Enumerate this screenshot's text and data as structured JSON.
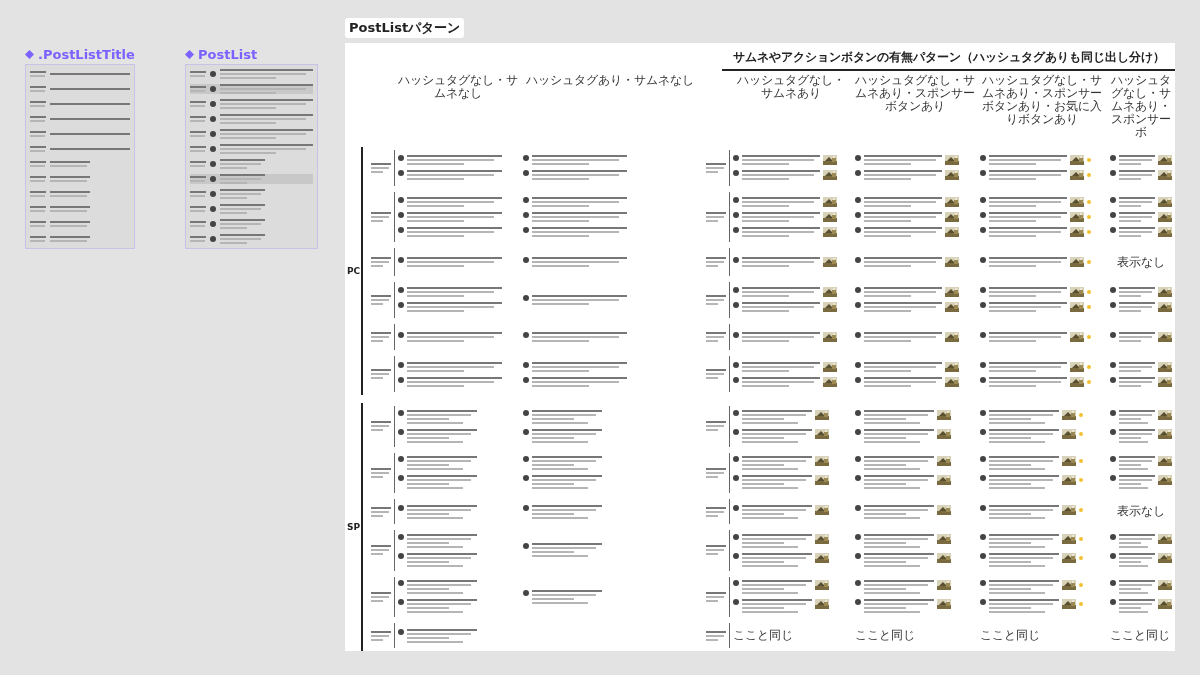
{
  "components": [
    {
      "title": ".PostListTitle",
      "kind": "title-list"
    },
    {
      "title": "PostList",
      "kind": "post-list"
    }
  ],
  "frame": {
    "title": "PostListパターン",
    "group_header": "サムネやアクションボタンの有無パターン（ハッシュタグありも同じ出し分け）",
    "columns": [
      {
        "header": "ハッシュタグなし・サムネなし",
        "thumbnail": false,
        "favorite": false
      },
      {
        "header": "ハッシュタグあり・サムネなし",
        "thumbnail": false,
        "favorite": false
      },
      {
        "header": "ハッシュタグなし・サムネあり",
        "thumbnail": true,
        "favorite": false
      },
      {
        "header": "ハッシュタグなし・サムネあり・スポンサーボタンあり",
        "thumbnail": true,
        "favorite": false
      },
      {
        "header": "ハッシュタグなし・サムネあり・スポンサーボタンあり・お気に入りボタンあり",
        "thumbnail": true,
        "favorite": true
      },
      {
        "header": "ハッシュタグなし・サムネあり・スポンサーボ",
        "thumbnail": true,
        "favorite": false
      }
    ],
    "sections": [
      {
        "label": "PC",
        "kind": "wide",
        "rows": [
          {
            "cells": [
              {
                "kind": "posts",
                "items": [
                  {
                    "kind": "post"
                  },
                  {
                    "kind": "post"
                  }
                ]
              },
              {
                "kind": "posts",
                "items": [
                  {
                    "kind": "post"
                  },
                  {
                    "kind": "post"
                  }
                ]
              },
              {
                "kind": "posts",
                "items": [
                  {
                    "kind": "post"
                  },
                  {
                    "kind": "post"
                  }
                ]
              },
              {
                "kind": "posts",
                "items": [
                  {
                    "kind": "post"
                  },
                  {
                    "kind": "post"
                  }
                ]
              },
              {
                "kind": "posts",
                "items": [
                  {
                    "kind": "post"
                  },
                  {
                    "kind": "post"
                  }
                ]
              },
              {
                "kind": "posts",
                "items": [
                  {
                    "kind": "post"
                  },
                  {
                    "kind": "post"
                  }
                ]
              }
            ]
          },
          {
            "cells": [
              {
                "kind": "posts",
                "items": [
                  {
                    "kind": "post"
                  },
                  {
                    "kind": "post"
                  },
                  {
                    "kind": "post"
                  }
                ]
              },
              {
                "kind": "posts",
                "items": [
                  {
                    "kind": "post"
                  },
                  {
                    "kind": "post"
                  },
                  {
                    "kind": "post"
                  }
                ]
              },
              {
                "kind": "posts",
                "items": [
                  {
                    "kind": "post"
                  },
                  {
                    "kind": "post"
                  },
                  {
                    "kind": "post"
                  }
                ]
              },
              {
                "kind": "posts",
                "items": [
                  {
                    "kind": "post"
                  },
                  {
                    "kind": "post"
                  },
                  {
                    "kind": "post"
                  }
                ]
              },
              {
                "kind": "posts",
                "items": [
                  {
                    "kind": "post"
                  },
                  {
                    "kind": "post"
                  },
                  {
                    "kind": "post"
                  }
                ]
              },
              {
                "kind": "posts",
                "items": [
                  {
                    "kind": "post"
                  },
                  {
                    "kind": "post"
                  },
                  {
                    "kind": "post"
                  }
                ]
              }
            ]
          },
          {
            "cells": [
              {
                "kind": "posts",
                "items": [
                  {
                    "kind": "post"
                  }
                ]
              },
              {
                "kind": "posts",
                "items": [
                  {
                    "kind": "post"
                  }
                ]
              },
              {
                "kind": "posts",
                "items": [
                  {
                    "kind": "post"
                  }
                ]
              },
              {
                "kind": "posts",
                "items": [
                  {
                    "kind": "post"
                  }
                ]
              },
              {
                "kind": "posts",
                "items": [
                  {
                    "kind": "post"
                  }
                ]
              },
              {
                "kind": "note",
                "text": "表示なし"
              }
            ]
          },
          {
            "cells": [
              {
                "kind": "posts",
                "items": [
                  {
                    "kind": "post"
                  },
                  {
                    "kind": "post"
                  }
                ]
              },
              {
                "kind": "posts",
                "items": [
                  {
                    "kind": "post"
                  }
                ]
              },
              {
                "kind": "posts",
                "items": [
                  {
                    "kind": "post"
                  },
                  {
                    "kind": "post"
                  }
                ]
              },
              {
                "kind": "posts",
                "items": [
                  {
                    "kind": "post"
                  },
                  {
                    "kind": "post"
                  }
                ]
              },
              {
                "kind": "posts",
                "items": [
                  {
                    "kind": "post"
                  },
                  {
                    "kind": "post"
                  }
                ]
              },
              {
                "kind": "posts",
                "items": [
                  {
                    "kind": "post"
                  },
                  {
                    "kind": "post"
                  }
                ]
              }
            ]
          },
          {
            "cells": [
              {
                "kind": "posts",
                "items": [
                  {
                    "kind": "post"
                  }
                ]
              },
              {
                "kind": "posts",
                "items": [
                  {
                    "kind": "post"
                  }
                ]
              },
              {
                "kind": "posts",
                "items": [
                  {
                    "kind": "post"
                  }
                ]
              },
              {
                "kind": "posts",
                "items": [
                  {
                    "kind": "post"
                  }
                ]
              },
              {
                "kind": "posts",
                "items": [
                  {
                    "kind": "post"
                  }
                ]
              },
              {
                "kind": "posts",
                "items": [
                  {
                    "kind": "post"
                  }
                ]
              }
            ]
          },
          {
            "cells": [
              {
                "kind": "posts",
                "items": [
                  {
                    "kind": "post"
                  },
                  {
                    "kind": "post"
                  }
                ]
              },
              {
                "kind": "posts",
                "items": [
                  {
                    "kind": "post"
                  },
                  {
                    "kind": "post"
                  }
                ]
              },
              {
                "kind": "posts",
                "items": [
                  {
                    "kind": "post"
                  },
                  {
                    "kind": "post"
                  }
                ]
              },
              {
                "kind": "posts",
                "items": [
                  {
                    "kind": "post"
                  },
                  {
                    "kind": "post"
                  }
                ]
              },
              {
                "kind": "posts",
                "items": [
                  {
                    "kind": "post"
                  },
                  {
                    "kind": "post"
                  }
                ]
              },
              {
                "kind": "posts",
                "items": [
                  {
                    "kind": "post"
                  },
                  {
                    "kind": "post"
                  }
                ]
              }
            ]
          }
        ]
      },
      {
        "label": "SP",
        "kind": "narrow",
        "rows": [
          {
            "cells": [
              {
                "kind": "posts",
                "items": [
                  {
                    "kind": "post"
                  },
                  {
                    "kind": "post"
                  }
                ]
              },
              {
                "kind": "posts",
                "items": [
                  {
                    "kind": "post"
                  },
                  {
                    "kind": "post"
                  }
                ]
              },
              {
                "kind": "posts",
                "items": [
                  {
                    "kind": "post"
                  },
                  {
                    "kind": "post"
                  }
                ]
              },
              {
                "kind": "posts",
                "items": [
                  {
                    "kind": "post"
                  },
                  {
                    "kind": "post"
                  }
                ]
              },
              {
                "kind": "posts",
                "items": [
                  {
                    "kind": "post"
                  },
                  {
                    "kind": "post"
                  }
                ]
              },
              {
                "kind": "posts",
                "items": [
                  {
                    "kind": "post"
                  },
                  {
                    "kind": "post"
                  }
                ]
              }
            ]
          },
          {
            "cells": [
              {
                "kind": "posts",
                "items": [
                  {
                    "kind": "post"
                  },
                  {
                    "kind": "post"
                  }
                ]
              },
              {
                "kind": "posts",
                "items": [
                  {
                    "kind": "post"
                  },
                  {
                    "kind": "post"
                  }
                ]
              },
              {
                "kind": "posts",
                "items": [
                  {
                    "kind": "post"
                  },
                  {
                    "kind": "post"
                  }
                ]
              },
              {
                "kind": "posts",
                "items": [
                  {
                    "kind": "post"
                  },
                  {
                    "kind": "post"
                  }
                ]
              },
              {
                "kind": "posts",
                "items": [
                  {
                    "kind": "post"
                  },
                  {
                    "kind": "post"
                  }
                ]
              },
              {
                "kind": "posts",
                "items": [
                  {
                    "kind": "post"
                  },
                  {
                    "kind": "post"
                  }
                ]
              }
            ]
          },
          {
            "cells": [
              {
                "kind": "posts",
                "items": [
                  {
                    "kind": "post"
                  }
                ]
              },
              {
                "kind": "posts",
                "items": [
                  {
                    "kind": "post"
                  }
                ]
              },
              {
                "kind": "posts",
                "items": [
                  {
                    "kind": "post"
                  }
                ]
              },
              {
                "kind": "posts",
                "items": [
                  {
                    "kind": "post"
                  }
                ]
              },
              {
                "kind": "posts",
                "items": [
                  {
                    "kind": "post"
                  }
                ]
              },
              {
                "kind": "note",
                "text": "表示なし"
              }
            ]
          },
          {
            "cells": [
              {
                "kind": "posts",
                "items": [
                  {
                    "kind": "post"
                  },
                  {
                    "kind": "post"
                  }
                ]
              },
              {
                "kind": "posts",
                "items": [
                  {
                    "kind": "post"
                  }
                ]
              },
              {
                "kind": "posts",
                "items": [
                  {
                    "kind": "post"
                  },
                  {
                    "kind": "post"
                  }
                ]
              },
              {
                "kind": "posts",
                "items": [
                  {
                    "kind": "post"
                  },
                  {
                    "kind": "post"
                  }
                ]
              },
              {
                "kind": "posts",
                "items": [
                  {
                    "kind": "post"
                  },
                  {
                    "kind": "post"
                  }
                ]
              },
              {
                "kind": "posts",
                "items": [
                  {
                    "kind": "post"
                  },
                  {
                    "kind": "post"
                  }
                ]
              }
            ]
          },
          {
            "cells": [
              {
                "kind": "posts",
                "items": [
                  {
                    "kind": "post"
                  },
                  {
                    "kind": "post"
                  }
                ]
              },
              {
                "kind": "posts",
                "items": [
                  {
                    "kind": "post"
                  }
                ]
              },
              {
                "kind": "posts",
                "items": [
                  {
                    "kind": "post"
                  },
                  {
                    "kind": "post"
                  }
                ]
              },
              {
                "kind": "posts",
                "items": [
                  {
                    "kind": "post"
                  },
                  {
                    "kind": "post"
                  }
                ]
              },
              {
                "kind": "posts",
                "items": [
                  {
                    "kind": "post"
                  },
                  {
                    "kind": "post"
                  }
                ]
              },
              {
                "kind": "posts",
                "items": [
                  {
                    "kind": "post"
                  },
                  {
                    "kind": "post"
                  }
                ]
              }
            ]
          },
          {
            "cells": [
              {
                "kind": "posts",
                "items": [
                  {
                    "kind": "post"
                  }
                ]
              },
              {
                "kind": "blank"
              },
              {
                "kind": "same",
                "text": "ここと同じ"
              },
              {
                "kind": "same",
                "text": "ここと同じ"
              },
              {
                "kind": "same",
                "text": "ここと同じ"
              },
              {
                "kind": "same",
                "text": "ここと同じ"
              }
            ]
          }
        ]
      }
    ]
  }
}
